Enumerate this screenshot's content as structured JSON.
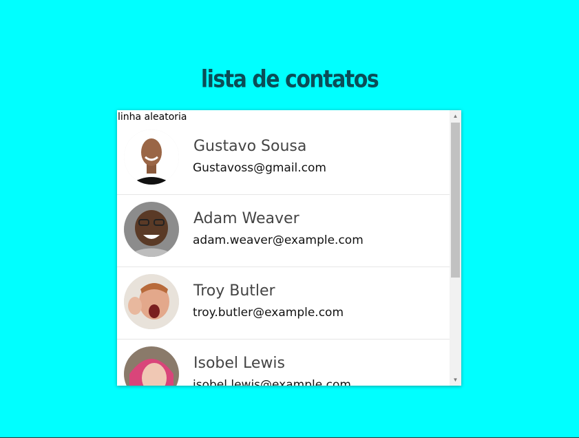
{
  "page": {
    "title": "lista de contatos"
  },
  "list": {
    "random_line": "linha aleatoria",
    "contacts": [
      {
        "name": "Gustavo Sousa",
        "email": "Gustavoss@gmail.com"
      },
      {
        "name": "Adam Weaver",
        "email": "adam.weaver@example.com"
      },
      {
        "name": "Troy Butler",
        "email": "troy.butler@example.com"
      },
      {
        "name": "Isobel Lewis",
        "email": "isobel.lewis@example.com"
      }
    ]
  },
  "scrollbar": {
    "up_icon": "triangle-up-icon",
    "down_icon": "triangle-down-icon"
  },
  "colors": {
    "background": "#00ffff",
    "title": "#0b4d57"
  }
}
